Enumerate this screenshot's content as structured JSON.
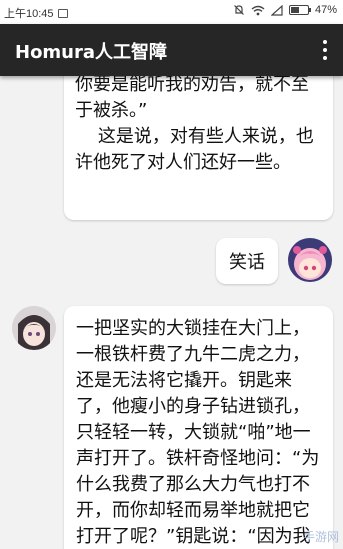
{
  "status_bar": {
    "time": "上午10:45",
    "battery_percent": "47%",
    "battery_level": 0.47
  },
  "app_bar": {
    "title": "Homura人工智障",
    "menu_icon": "more-vert-icon"
  },
  "messages": [
    {
      "sender": "bot",
      "text": "了，也用不着真诚、正直了，你要是能听我的劝告，就不至于被杀。”\n    这是说，对有些人来说，也许他死了对人们还好一些。"
    },
    {
      "sender": "user",
      "text": "笑话",
      "avatar": "pink-hair-anime-avatar"
    },
    {
      "sender": "bot",
      "avatar": "dark-hair-anime-avatar",
      "text": "一把坚实的大锁挂在大门上，一根铁杆费了九牛二虎之力，还是无法将它撬开。钥匙来了，他瘦小的身子钻进锁孔，只轻轻一转，大锁就“啪”地一声打开了。铁杆奇怪地问：“为什么我费了那么大力气也打不开，而你却轻而易举地就把它打开了呢？”钥匙说：“因为我最了解他的心。”"
    }
  ],
  "watermark": "手游网",
  "colors": {
    "appbar_bg": "#262626",
    "chat_bg": "#f2f2f2",
    "bubble_bg": "#ffffff"
  }
}
